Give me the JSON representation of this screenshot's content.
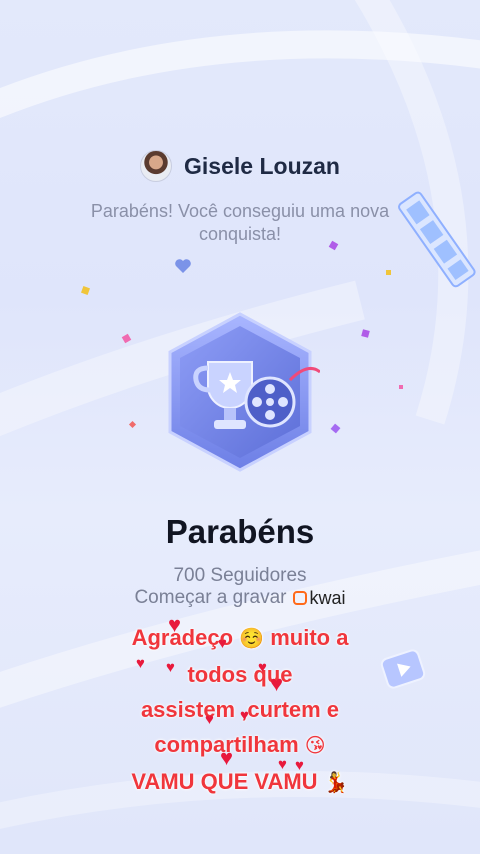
{
  "header": {
    "username": "Gisele Louzan",
    "subtitle": "Parabéns! Você conseguiu uma nova conquista!"
  },
  "achievement": {
    "title": "Parabéns",
    "followers": "700 Seguidores",
    "record_label": "Começar a gravar",
    "brand": "kwai"
  },
  "message": {
    "line1_a": "Agradeço",
    "line1_emoji": "☺️",
    "line1_b": "muito a",
    "line2": "todos que",
    "line3": "assistem ,curtem e",
    "line4": "compartilham",
    "line4_emoji": "😘",
    "line5": "VAMU QUE VAMU",
    "line5_emoji": "💃"
  },
  "icons": {
    "badge": "trophy-film-reel-badge-icon",
    "heart": "heart-icon",
    "play": "play-icon",
    "film": "film-strip-icon"
  },
  "colors": {
    "message_text": "#f0363c",
    "badge_main": "#7e8ff0",
    "background": "#e3e9fb",
    "kwai_brand": "#ff6a1a"
  }
}
